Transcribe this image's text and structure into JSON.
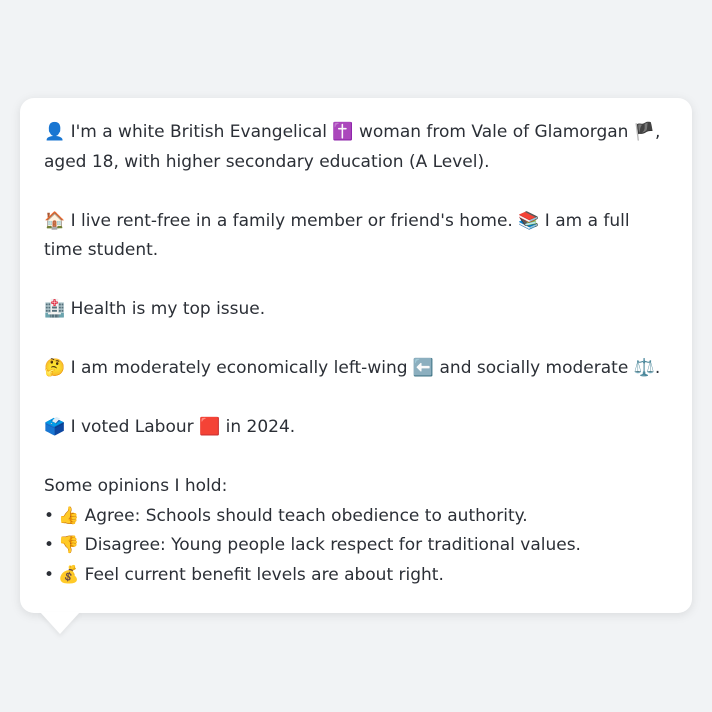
{
  "profile": {
    "p1": {
      "emoji_person": "👤",
      "text_a": "I'm a white British Evangelical",
      "emoji_cross": "✝️",
      "text_b": "woman from Vale of Glamorgan",
      "emoji_flag": "🏴",
      "text_c": ", aged 18, with higher secondary education (A Level)."
    },
    "p2": {
      "emoji_house": "🏠",
      "text_a": "I live rent-free in a family member or friend's home.",
      "emoji_books": "📚",
      "text_b": "I am a full time student."
    },
    "p3": {
      "emoji_hospital": "🏥",
      "text": "Health is my top issue."
    },
    "p4": {
      "emoji_thinking": "🤔",
      "text_a": "I am moderately economically left-wing",
      "emoji_left": "⬅️",
      "text_b": "and socially moderate",
      "emoji_scales": "⚖️",
      "text_c": "."
    },
    "p5": {
      "emoji_ballot": "🗳️",
      "text_a": "I voted Labour",
      "emoji_red": "🟥",
      "text_b": "in 2024."
    },
    "opinions": {
      "heading": "Some opinions I hold:",
      "bullet": "•",
      "items": [
        {
          "emoji": "👍",
          "text": "Agree: Schools should teach obedience to authority."
        },
        {
          "emoji": "👎",
          "text": "Disagree: Young people lack respect for traditional values."
        },
        {
          "emoji": "💰",
          "text": "Feel current benefit levels are about right."
        }
      ]
    }
  }
}
